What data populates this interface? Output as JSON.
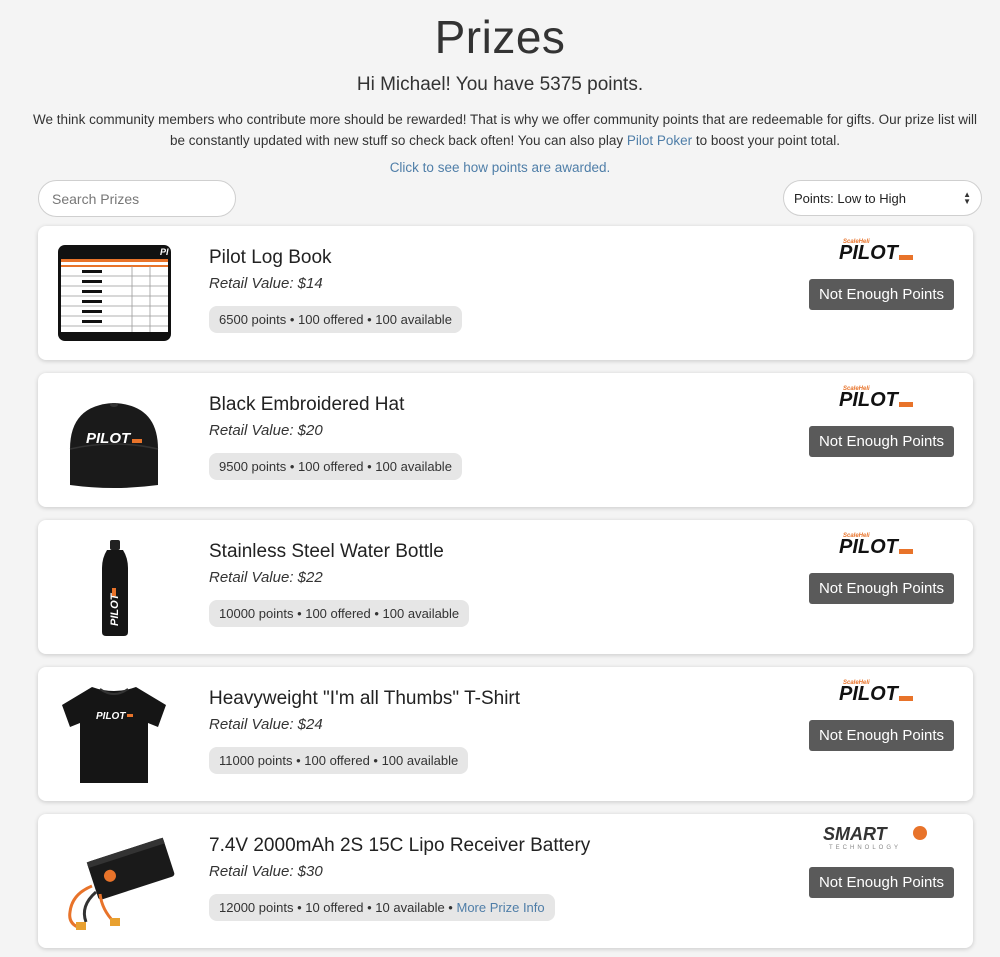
{
  "header": {
    "title": "Prizes",
    "greeting": "Hi Michael! You have 5375 points.",
    "intro_part1": "We think community members who contribute more should be rewarded! That is why we offer community points that are redeemable for gifts.  Our prize list will be constantly updated with new stuff so check back often! You can also play ",
    "intro_link": "Pilot Poker",
    "intro_part2": " to boost your point total.",
    "howto_link": "Click to see how points are awarded."
  },
  "controls": {
    "search_placeholder": "Search Prizes",
    "sort_value": "Points: Low to High"
  },
  "prizes": [
    {
      "name": "Pilot Log Book",
      "retail": "Retail Value: $14",
      "details": "6500 points • 100 offered • 100 available",
      "more": "",
      "button": "Not Enough Points",
      "brand": "PILOT",
      "brand_small": "ScaleHeli"
    },
    {
      "name": "Black Embroidered Hat",
      "retail": "Retail Value: $20",
      "details": "9500 points • 100 offered • 100 available",
      "more": "",
      "button": "Not Enough Points",
      "brand": "PILOT",
      "brand_small": "ScaleHeli"
    },
    {
      "name": "Stainless Steel Water Bottle",
      "retail": "Retail Value: $22",
      "details": "10000 points • 100 offered • 100 available",
      "more": "",
      "button": "Not Enough Points",
      "brand": "PILOT",
      "brand_small": "ScaleHeli"
    },
    {
      "name": "Heavyweight \"I'm all Thumbs\" T-Shirt",
      "retail": "Retail Value: $24",
      "details": "11000 points • 100 offered • 100 available",
      "more": "",
      "button": "Not Enough Points",
      "brand": "PILOT",
      "brand_small": "ScaleHeli"
    },
    {
      "name": "7.4V 2000mAh 2S 15C Lipo Receiver Battery",
      "retail": "Retail Value: $30",
      "details": "12000 points • 10 offered • 10 available • ",
      "more": "More Prize Info",
      "button": "Not Enough Points",
      "brand": "SMART",
      "brand_small": "TECHNOLOGY"
    }
  ],
  "colors": {
    "accent_link": "#4f7ea8",
    "button_bg": "#5a5a5a",
    "brand_orange": "#e8732a"
  }
}
